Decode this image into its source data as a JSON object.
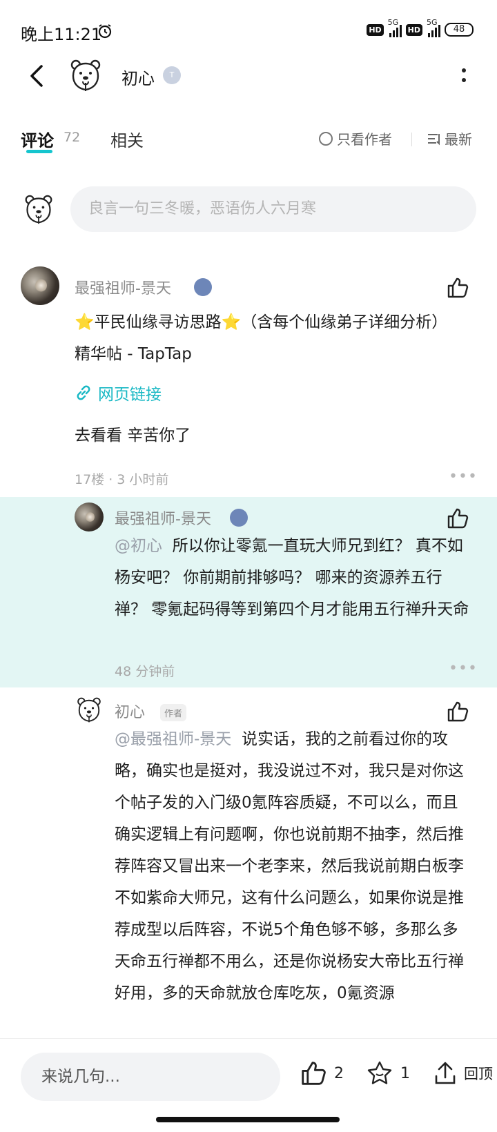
{
  "status_bar": {
    "time": "晚上11:21",
    "network_hd": "HD",
    "network_gen": "5G",
    "battery": "48"
  },
  "header": {
    "user_name": "初心",
    "level_badge": "T"
  },
  "tabs": {
    "comments_label": "评论",
    "comments_count": "72",
    "related_label": "相关",
    "author_only_label": "只看作者",
    "sort_label": "最新"
  },
  "comment_box": {
    "placeholder": "良言一句三冬暖，恶语伤人六月寒"
  },
  "main_comment": {
    "user": "最强祖师-景天",
    "title": "⭐平民仙缘寻访思路⭐（含每个仙缘弟子详细分析） 精华帖 - TapTap",
    "link_label": "网页链接",
    "text": "去看看 辛苦你了",
    "meta": "17楼 · 3 小时前"
  },
  "replies": [
    {
      "user": "最强祖师-景天",
      "mention": "@初心",
      "text": "所以你让零氪一直玩大师兄到红？ 真不如杨安吧？ 你前期前排够吗？ 哪来的资源养五行禅？ 零氪起码得等到第四个月才能用五行禅升天命",
      "meta": "48 分钟前"
    },
    {
      "user": "初心",
      "author_tag": "作者",
      "mention": "@最强祖师-景天",
      "text": "说实话，我的之前看过你的攻略，确实也是挺对，我没说过不对，我只是对你这个帖子发的入门级0氪阵容质疑，不可以么，而且确实逻辑上有问题啊，你也说前期不抽李，然后推荐阵容又冒出来一个老李来，然后我说前期白板李不如紫命大师兄，这有什么问题么，如果你说是推荐成型以后阵容，不说5个角色够不够，多那么多天命五行禅都不用么，还是你说杨安大帝比五行禅好用，多的天命就放仓库吃灰，0氪资源"
    }
  ],
  "bottom_bar": {
    "input_placeholder": "来说几句...",
    "like_count": "2",
    "star_count": "1",
    "back_top_label": "回顶"
  },
  "colors": {
    "accent": "#15c5ce",
    "highlight_bg": "#e3f6f4",
    "link": "#18b8c4"
  }
}
